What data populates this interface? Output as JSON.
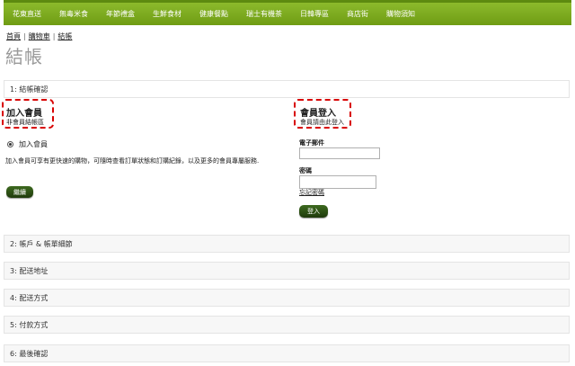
{
  "nav": {
    "items": [
      "花東直送",
      "無毒米食",
      "年節禮盒",
      "生鮮食材",
      "健康餐點",
      "瑞士有機茶",
      "日韓專區",
      "商店街",
      "購物須知"
    ]
  },
  "breadcrumb": [
    "首頁",
    "購物車",
    "結帳"
  ],
  "page_title": "結帳",
  "steps": [
    "1: 結帳確認",
    "2: 帳戶 & 帳單細節",
    "3: 配送地址",
    "4: 配送方式",
    "5: 付款方式",
    "6: 最後確認"
  ],
  "join": {
    "heading": "加入會員",
    "subheading": "非會員結帳區",
    "option_label": "加入會員",
    "description": "加入會員可享有更快速的購物，可隨時查看訂單狀態和訂購紀錄，以及更多的會員專屬服務.",
    "continue_button": "繼續"
  },
  "login": {
    "heading": "會員登入",
    "subheading": "會員請由此登入",
    "email_label": "電子郵件",
    "password_label": "密碼",
    "forgot_link": "忘記密碼",
    "login_button": "登入"
  },
  "colors": {
    "nav_green": "#7aa91d",
    "highlight_red": "#d80000",
    "button_dark_green": "#2c4f15"
  }
}
